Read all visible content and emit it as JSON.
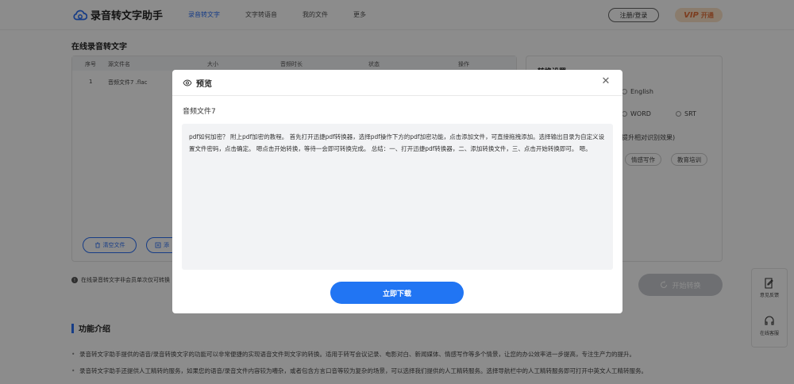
{
  "header": {
    "logo_text": "录音转文字助手",
    "nav": [
      "录音转文字",
      "文字转语音",
      "我的文件",
      "更多"
    ],
    "login": "注册/登录",
    "vip": "VIP",
    "vip_open": "开通"
  },
  "page": {
    "title": "在线录音转文字",
    "table": {
      "columns": [
        "序号",
        "源文件名",
        "大小",
        "音频时长",
        "状态",
        "操作"
      ],
      "rows": [
        [
          "1",
          "音频文件7 .flac"
        ]
      ]
    },
    "buttons": {
      "clear": "清空文件",
      "add": "添"
    },
    "notice": "在线录音转文字非会员单次仅可转换",
    "start": "开始转换"
  },
  "settings": {
    "title": "转换设置",
    "language_option": "English",
    "format_options": [
      "WORD",
      "SRT"
    ],
    "hint": "提升相对识别效果)",
    "tags": [
      "情感写作",
      "教育培训"
    ]
  },
  "intro": {
    "title": "功能介绍",
    "items": [
      "录音转文字助手提供的语音/录音转换文字的功能可以非常便捷的实现语音文件到文字的转换。适用于转写会议记录、电影对白、新闻媒体、情感写作等多个情景，让您的办公效率进一步提高，专注生产力的提升。",
      "录音转文字助手还提供人工精转的服务，如果您的语音/录音文件内容较为嘈杂，或者包含方言口音等较为复杂的场景，可以选择我们提供的人工精转服务。选择导航栏中的人工精转服务即可打开中英文人工精转服务。"
    ]
  },
  "side": {
    "feedback": "意见反馈",
    "service": "在线客服"
  },
  "modal": {
    "title": "预览",
    "filename": "音频文件7",
    "content": "pdf如何加密？ 附上pdf加密的教程。 首先打开迅捷pdf转换器，选择pdf操作下方的pdf加密功能，点击添加文件，可直接拖拽添加。选择输出目录为自定义设置文件密码，点击确定。 嗯点击开始转换，等待一会即可转换完成。 总结：一、打开迅捷pdf转换器，二、添加转换文件，三、点击开始转换即可。 嗯。",
    "download": "立即下载"
  },
  "colors": {
    "accent": "#2175f3",
    "overlay": "rgba(0,0,0,0.45)"
  }
}
